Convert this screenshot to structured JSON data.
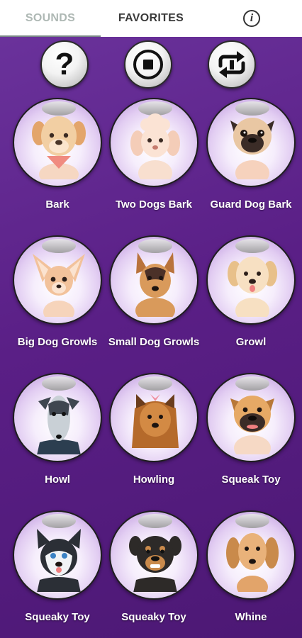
{
  "tabs": {
    "sounds": "SOUNDS",
    "favorites": "FAVORITES",
    "info": "i"
  },
  "controls": {
    "help": "?",
    "stop": "stop-icon",
    "repeat": "repeat-icon"
  },
  "sounds": [
    {
      "label": "Bark",
      "dog": "labrador-puppy-bandana"
    },
    {
      "label": "Two Dogs Bark",
      "dog": "poodle"
    },
    {
      "label": "Guard Dog Bark",
      "dog": "pug"
    },
    {
      "label": "Big Dog Growls",
      "dog": "chihuahua"
    },
    {
      "label": "Small Dog Growls",
      "dog": "german-shepherd"
    },
    {
      "label": "Growl",
      "dog": "golden-retriever"
    },
    {
      "label": "Howl",
      "dog": "greyhound"
    },
    {
      "label": "Howling",
      "dog": "yorkshire-terrier"
    },
    {
      "label": "Squeak Toy",
      "dog": "boxer"
    },
    {
      "label": "Squeaky Toy",
      "dog": "husky"
    },
    {
      "label": "Squeaky Toy",
      "dog": "rottweiler"
    },
    {
      "label": "Whine",
      "dog": "dachshund"
    }
  ],
  "colors": {
    "background": "#5a1f86",
    "tab_active": "#aeb8b4",
    "tab_inactive": "#3a3a3a"
  }
}
